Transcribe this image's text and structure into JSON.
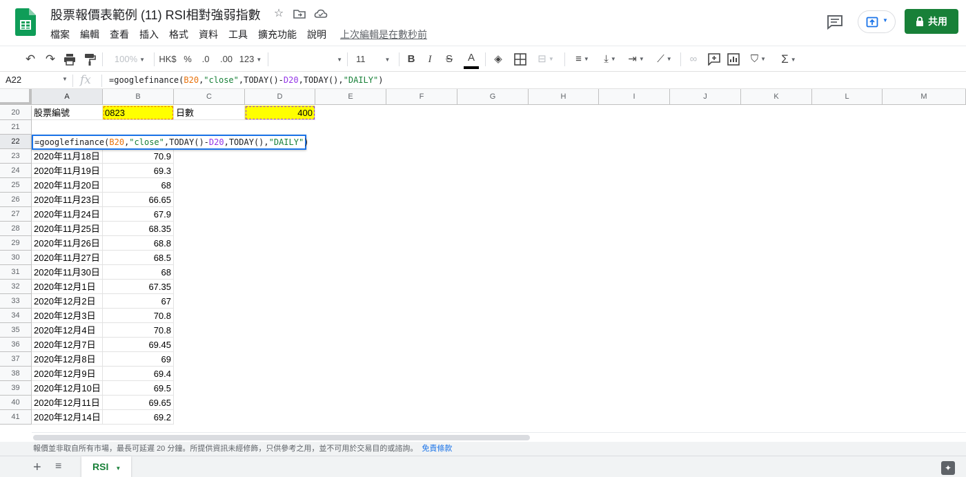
{
  "title": "股票報價表範例 (11) RSI相對強弱指數",
  "menu": [
    "檔案",
    "編輯",
    "查看",
    "插入",
    "格式",
    "資料",
    "工具",
    "擴充功能",
    "說明"
  ],
  "last_edit": "上次編輯是在數秒前",
  "share_label": "共用",
  "toolbar": {
    "zoom": "100%",
    "currency": "HK$",
    "percent": "%",
    "dec_decrease": ".0",
    "dec_increase": ".00",
    "format_123": "123",
    "font_size": "11",
    "bold": "B",
    "italic": "I",
    "strike": "S",
    "text_color": "A"
  },
  "name_box": "A22",
  "fx_label": "fx",
  "formula": "=googlefinance(B20,\"close\",TODAY()-D20,TODAY(),\"DAILY\")",
  "columns": [
    "A",
    "B",
    "C",
    "D",
    "E",
    "F",
    "G",
    "H",
    "I",
    "J",
    "K",
    "L",
    "M"
  ],
  "row20": {
    "num": "20",
    "a": "股票編號",
    "b": "0823",
    "c": "日數",
    "d": "400"
  },
  "row21": {
    "num": "21"
  },
  "row22": {
    "num": "22"
  },
  "editor": {
    "p1": "=googlefinance(",
    "ref_b": "B20",
    "p2": ",",
    "s1": "\"close\"",
    "p3": ",TODAY()-",
    "ref_d": "D20",
    "p4": ",TODAY(),",
    "s2": "\"DAILY\"",
    "p5": ")"
  },
  "data_rows": [
    {
      "num": "23",
      "date": "2020年11月18日",
      "close": "70.9"
    },
    {
      "num": "24",
      "date": "2020年11月19日",
      "close": "69.3"
    },
    {
      "num": "25",
      "date": "2020年11月20日",
      "close": "68"
    },
    {
      "num": "26",
      "date": "2020年11月23日",
      "close": "66.65"
    },
    {
      "num": "27",
      "date": "2020年11月24日",
      "close": "67.9"
    },
    {
      "num": "28",
      "date": "2020年11月25日",
      "close": "68.35"
    },
    {
      "num": "29",
      "date": "2020年11月26日",
      "close": "68.8"
    },
    {
      "num": "30",
      "date": "2020年11月27日",
      "close": "68.5"
    },
    {
      "num": "31",
      "date": "2020年11月30日",
      "close": "68"
    },
    {
      "num": "32",
      "date": "2020年12月1日",
      "close": "67.35"
    },
    {
      "num": "33",
      "date": "2020年12月2日",
      "close": "67"
    },
    {
      "num": "34",
      "date": "2020年12月3日",
      "close": "70.8"
    },
    {
      "num": "35",
      "date": "2020年12月4日",
      "close": "70.8"
    },
    {
      "num": "36",
      "date": "2020年12月7日",
      "close": "69.45"
    },
    {
      "num": "37",
      "date": "2020年12月8日",
      "close": "69"
    },
    {
      "num": "38",
      "date": "2020年12月9日",
      "close": "69.4"
    },
    {
      "num": "39",
      "date": "2020年12月10日",
      "close": "69.5"
    },
    {
      "num": "40",
      "date": "2020年12月11日",
      "close": "69.65"
    },
    {
      "num": "41",
      "date": "2020年12月14日",
      "close": "69.2"
    }
  ],
  "disclaimer": "報價並非取自所有市場，最長可延遲 20 分鐘。所提供資訊未經修飾，只供參考之用，並不可用於交易目的或諮詢。",
  "terms_link": "免責條款",
  "sheet_tab": "RSI",
  "colors": {
    "brand_green": "#188038",
    "highlight_yellow": "#ffff00",
    "selection_blue": "#1a73e8",
    "ref_orange": "#e8710a",
    "ref_purple": "#9334e6"
  },
  "icons": {
    "logo": "sheets-logo-icon",
    "star": "star-icon",
    "move": "folder-move-icon",
    "cloud": "cloud-status-icon",
    "comment": "comment-history-icon",
    "present": "present-icon",
    "lock": "lock-icon"
  }
}
